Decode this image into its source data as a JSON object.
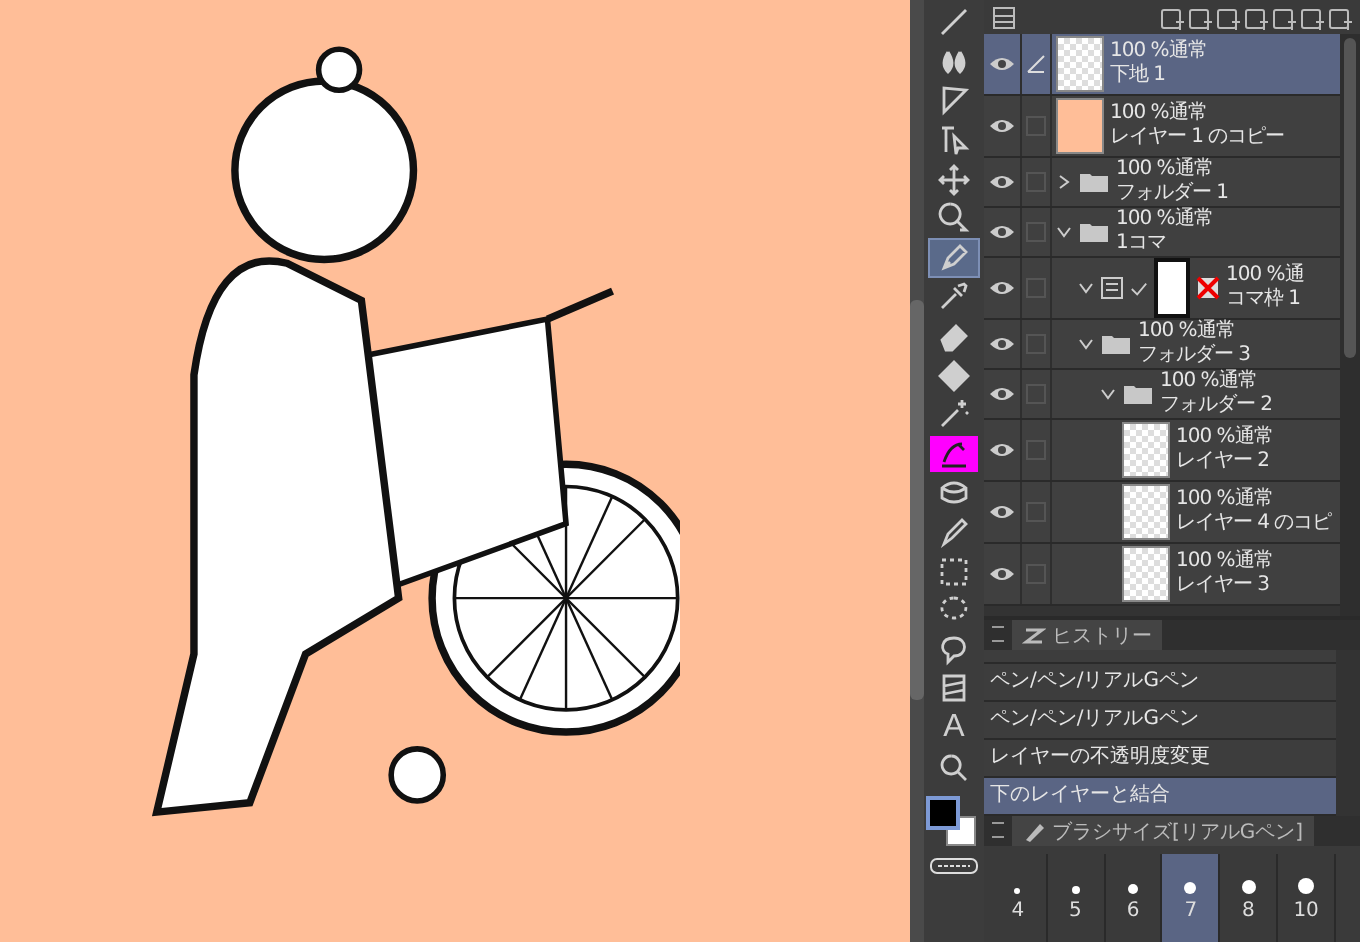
{
  "tools": [
    {
      "kind": "line",
      "selected": false
    },
    {
      "kind": "drop",
      "selected": false
    },
    {
      "kind": "ruler",
      "selected": false
    },
    {
      "kind": "pointer",
      "selected": false
    },
    {
      "kind": "move",
      "selected": false
    },
    {
      "kind": "zoom-pointer",
      "selected": false
    },
    {
      "kind": "pen",
      "selected": true
    },
    {
      "kind": "eyedropper",
      "selected": false
    },
    {
      "kind": "eraser",
      "selected": false
    },
    {
      "kind": "fill",
      "selected": false
    },
    {
      "kind": "wand",
      "selected": false
    },
    {
      "kind": "magenta-brush",
      "selected": false
    },
    {
      "kind": "blend",
      "selected": false
    },
    {
      "kind": "marker",
      "selected": false
    },
    {
      "kind": "select",
      "selected": false
    },
    {
      "kind": "lasso",
      "selected": false
    },
    {
      "kind": "balloon",
      "selected": false
    },
    {
      "kind": "panel",
      "selected": false
    },
    {
      "kind": "text",
      "selected": false,
      "glyph": "A"
    },
    {
      "kind": "search",
      "selected": false
    }
  ],
  "layers": [
    {
      "kind": "raster",
      "mode": "100 %通常",
      "name": "下地 1",
      "visible": true,
      "selected": true
    },
    {
      "kind": "fill",
      "mode": "100 %通常",
      "name": "レイヤー 1 のコピー",
      "visible": true,
      "selected": false
    },
    {
      "kind": "folder",
      "mode": "100 %通常",
      "name": "フォルダー 1",
      "visible": true,
      "selected": false,
      "expanded": false
    },
    {
      "kind": "folder",
      "mode": "100 %通常",
      "name": "1コマ",
      "visible": true,
      "selected": false,
      "expanded": true,
      "children": [
        {
          "kind": "frame",
          "mode": "100 %通",
          "name": "コマ枠 1",
          "visible": true,
          "selected": false
        },
        {
          "kind": "folder",
          "mode": "100 %通常",
          "name": "フォルダー 3",
          "visible": true,
          "selected": false,
          "expanded": true,
          "children": [
            {
              "kind": "folder",
              "mode": "100 %通常",
              "name": "フォルダー 2",
              "visible": true,
              "selected": false,
              "expanded": true,
              "children": [
                {
                  "kind": "raster",
                  "mode": "100 %通常",
                  "name": "レイヤー 2",
                  "visible": true,
                  "selected": false
                },
                {
                  "kind": "raster",
                  "mode": "100 %通常",
                  "name": "レイヤー 4 のコピ",
                  "visible": true,
                  "selected": false
                },
                {
                  "kind": "raster",
                  "mode": "100 %通常",
                  "name": "レイヤー 3",
                  "visible": true,
                  "selected": false
                }
              ]
            }
          ]
        }
      ]
    }
  ],
  "history": {
    "tab": "ヒストリー",
    "items": [
      {
        "label": "ペン/ペン/リアルGペン",
        "selected": false
      },
      {
        "label": "ペン/ペン/リアルGペン",
        "selected": false
      },
      {
        "label": "レイヤーの不透明度変更",
        "selected": false
      },
      {
        "label": "下のレイヤーと結合",
        "selected": true
      }
    ]
  },
  "brush_size": {
    "tab": "ブラシサイズ[リアルGペン]",
    "sizes": [
      {
        "label": "4",
        "selected": false
      },
      {
        "label": "5",
        "selected": false
      },
      {
        "label": "6",
        "selected": false
      },
      {
        "label": "7",
        "selected": true
      },
      {
        "label": "8",
        "selected": false
      },
      {
        "label": "10",
        "selected": false
      }
    ]
  }
}
